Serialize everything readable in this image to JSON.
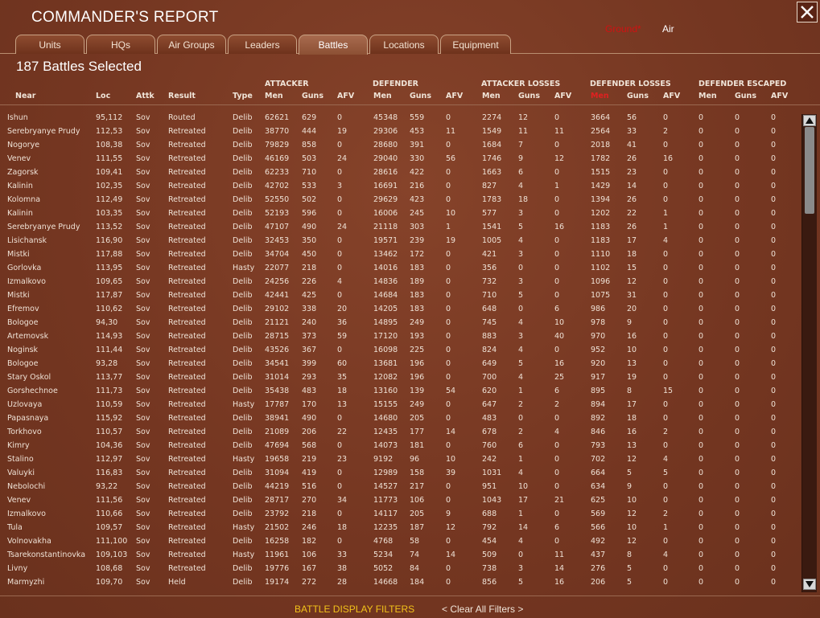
{
  "window": {
    "title": "COMMANDER'S REPORT"
  },
  "mode": {
    "ground": "Ground*",
    "air": "Air"
  },
  "tabs": [
    {
      "label": "Units"
    },
    {
      "label": "HQs"
    },
    {
      "label": "Air Groups"
    },
    {
      "label": "Leaders"
    },
    {
      "label": "Battles"
    },
    {
      "label": "Locations"
    },
    {
      "label": "Equipment"
    }
  ],
  "active_tab": "Battles",
  "selection_count": "187 Battles Selected",
  "groups": {
    "attacker": "ATTACKER",
    "defender": "DEFENDER",
    "attacker_losses": "ATTACKER LOSSES",
    "defender_losses": "DEFENDER LOSSES",
    "defender_escaped": "DEFENDER ESCAPED"
  },
  "columns": [
    "Near",
    "Loc",
    "Attk",
    "Result",
    "Type",
    "Men",
    "Guns",
    "AFV",
    "Men",
    "Guns",
    "AFV",
    "Men",
    "Guns",
    "AFV",
    "Men",
    "Guns",
    "AFV",
    "Men",
    "Guns",
    "AFV"
  ],
  "sorted_column_color": "#e02020",
  "rows": [
    [
      "Ishun",
      "95,112",
      "Sov",
      "Routed",
      "Delib",
      "62621",
      "629",
      "0",
      "45348",
      "559",
      "0",
      "2274",
      "12",
      "0",
      "3664",
      "56",
      "0",
      "0",
      "0",
      "0"
    ],
    [
      "Serebryanye Prudy",
      "112,53",
      "Sov",
      "Retreated",
      "Delib",
      "38770",
      "444",
      "19",
      "29306",
      "453",
      "11",
      "1549",
      "11",
      "11",
      "2564",
      "33",
      "2",
      "0",
      "0",
      "0"
    ],
    [
      "Nogorye",
      "108,38",
      "Sov",
      "Retreated",
      "Delib",
      "79829",
      "858",
      "0",
      "28680",
      "391",
      "0",
      "1684",
      "7",
      "0",
      "2018",
      "41",
      "0",
      "0",
      "0",
      "0"
    ],
    [
      "Venev",
      "111,55",
      "Sov",
      "Retreated",
      "Delib",
      "46169",
      "503",
      "24",
      "29040",
      "330",
      "56",
      "1746",
      "9",
      "12",
      "1782",
      "26",
      "16",
      "0",
      "0",
      "0"
    ],
    [
      "Zagorsk",
      "109,41",
      "Sov",
      "Retreated",
      "Delib",
      "62233",
      "710",
      "0",
      "28616",
      "422",
      "0",
      "1663",
      "6",
      "0",
      "1515",
      "23",
      "0",
      "0",
      "0",
      "0"
    ],
    [
      "Kalinin",
      "102,35",
      "Sov",
      "Retreated",
      "Delib",
      "42702",
      "533",
      "3",
      "16691",
      "216",
      "0",
      "827",
      "4",
      "1",
      "1429",
      "14",
      "0",
      "0",
      "0",
      "0"
    ],
    [
      "Kolomna",
      "112,49",
      "Sov",
      "Retreated",
      "Delib",
      "52550",
      "502",
      "0",
      "29629",
      "423",
      "0",
      "1783",
      "18",
      "0",
      "1394",
      "26",
      "0",
      "0",
      "0",
      "0"
    ],
    [
      "Kalinin",
      "103,35",
      "Sov",
      "Retreated",
      "Delib",
      "52193",
      "596",
      "0",
      "16006",
      "245",
      "10",
      "577",
      "3",
      "0",
      "1202",
      "22",
      "1",
      "0",
      "0",
      "0"
    ],
    [
      "Serebryanye Prudy",
      "113,52",
      "Sov",
      "Retreated",
      "Delib",
      "47107",
      "490",
      "24",
      "21118",
      "303",
      "1",
      "1541",
      "5",
      "16",
      "1183",
      "26",
      "1",
      "0",
      "0",
      "0"
    ],
    [
      "Lisichansk",
      "116,90",
      "Sov",
      "Retreated",
      "Delib",
      "32453",
      "350",
      "0",
      "19571",
      "239",
      "19",
      "1005",
      "4",
      "0",
      "1183",
      "17",
      "4",
      "0",
      "0",
      "0"
    ],
    [
      "Mistki",
      "117,88",
      "Sov",
      "Retreated",
      "Delib",
      "34704",
      "450",
      "0",
      "13462",
      "172",
      "0",
      "421",
      "3",
      "0",
      "1110",
      "18",
      "0",
      "0",
      "0",
      "0"
    ],
    [
      "Gorlovka",
      "113,95",
      "Sov",
      "Retreated",
      "Hasty",
      "22077",
      "218",
      "0",
      "14016",
      "183",
      "0",
      "356",
      "0",
      "0",
      "1102",
      "15",
      "0",
      "0",
      "0",
      "0"
    ],
    [
      "Izmalkovo",
      "109,65",
      "Sov",
      "Retreated",
      "Delib",
      "24256",
      "226",
      "4",
      "14836",
      "189",
      "0",
      "732",
      "3",
      "0",
      "1096",
      "12",
      "0",
      "0",
      "0",
      "0"
    ],
    [
      "Mistki",
      "117,87",
      "Sov",
      "Retreated",
      "Delib",
      "42441",
      "425",
      "0",
      "14684",
      "183",
      "0",
      "710",
      "5",
      "0",
      "1075",
      "31",
      "0",
      "0",
      "0",
      "0"
    ],
    [
      "Efremov",
      "110,62",
      "Sov",
      "Retreated",
      "Delib",
      "29102",
      "338",
      "20",
      "14205",
      "183",
      "0",
      "648",
      "0",
      "6",
      "986",
      "20",
      "0",
      "0",
      "0",
      "0"
    ],
    [
      "Bologoe",
      "94,30",
      "Sov",
      "Retreated",
      "Delib",
      "21121",
      "240",
      "36",
      "14895",
      "249",
      "0",
      "745",
      "4",
      "10",
      "978",
      "9",
      "0",
      "0",
      "0",
      "0"
    ],
    [
      "Artemovsk",
      "114,93",
      "Sov",
      "Retreated",
      "Delib",
      "28715",
      "373",
      "59",
      "17120",
      "193",
      "0",
      "883",
      "3",
      "40",
      "970",
      "16",
      "0",
      "0",
      "0",
      "0"
    ],
    [
      "Noginsk",
      "111,44",
      "Sov",
      "Retreated",
      "Delib",
      "43526",
      "367",
      "0",
      "16098",
      "225",
      "0",
      "824",
      "4",
      "0",
      "952",
      "10",
      "0",
      "0",
      "0",
      "0"
    ],
    [
      "Bologoe",
      "93,28",
      "Sov",
      "Retreated",
      "Delib",
      "34541",
      "399",
      "60",
      "13681",
      "196",
      "0",
      "649",
      "5",
      "16",
      "920",
      "13",
      "0",
      "0",
      "0",
      "0"
    ],
    [
      "Stary Oskol",
      "113,77",
      "Sov",
      "Retreated",
      "Delib",
      "31014",
      "293",
      "35",
      "12082",
      "196",
      "0",
      "700",
      "4",
      "25",
      "917",
      "19",
      "0",
      "0",
      "0",
      "0"
    ],
    [
      "Gorshechnoe",
      "111,73",
      "Sov",
      "Retreated",
      "Delib",
      "35438",
      "483",
      "18",
      "13160",
      "139",
      "54",
      "620",
      "1",
      "6",
      "895",
      "8",
      "15",
      "0",
      "0",
      "0"
    ],
    [
      "Uzlovaya",
      "110,59",
      "Sov",
      "Retreated",
      "Hasty",
      "17787",
      "170",
      "13",
      "15155",
      "249",
      "0",
      "647",
      "2",
      "2",
      "894",
      "17",
      "0",
      "0",
      "0",
      "0"
    ],
    [
      "Papasnaya",
      "115,92",
      "Sov",
      "Retreated",
      "Delib",
      "38941",
      "490",
      "0",
      "14680",
      "205",
      "0",
      "483",
      "0",
      "0",
      "892",
      "18",
      "0",
      "0",
      "0",
      "0"
    ],
    [
      "Torkhovo",
      "110,57",
      "Sov",
      "Retreated",
      "Delib",
      "21089",
      "206",
      "22",
      "12435",
      "177",
      "14",
      "678",
      "2",
      "4",
      "846",
      "16",
      "2",
      "0",
      "0",
      "0"
    ],
    [
      "Kimry",
      "104,36",
      "Sov",
      "Retreated",
      "Delib",
      "47694",
      "568",
      "0",
      "14073",
      "181",
      "0",
      "760",
      "6",
      "0",
      "793",
      "13",
      "0",
      "0",
      "0",
      "0"
    ],
    [
      "Stalino",
      "112,97",
      "Sov",
      "Retreated",
      "Hasty",
      "19658",
      "219",
      "23",
      "9192",
      "96",
      "10",
      "242",
      "1",
      "0",
      "702",
      "12",
      "4",
      "0",
      "0",
      "0"
    ],
    [
      "Valuyki",
      "116,83",
      "Sov",
      "Retreated",
      "Delib",
      "31094",
      "419",
      "0",
      "12989",
      "158",
      "39",
      "1031",
      "4",
      "0",
      "664",
      "5",
      "5",
      "0",
      "0",
      "0"
    ],
    [
      "Nebolochi",
      "93,22",
      "Sov",
      "Retreated",
      "Delib",
      "44219",
      "516",
      "0",
      "14527",
      "217",
      "0",
      "951",
      "10",
      "0",
      "634",
      "9",
      "0",
      "0",
      "0",
      "0"
    ],
    [
      "Venev",
      "111,56",
      "Sov",
      "Retreated",
      "Delib",
      "28717",
      "270",
      "34",
      "11773",
      "106",
      "0",
      "1043",
      "17",
      "21",
      "625",
      "10",
      "0",
      "0",
      "0",
      "0"
    ],
    [
      "Izmalkovo",
      "110,66",
      "Sov",
      "Retreated",
      "Delib",
      "23792",
      "218",
      "0",
      "14117",
      "205",
      "9",
      "688",
      "1",
      "0",
      "569",
      "12",
      "2",
      "0",
      "0",
      "0"
    ],
    [
      "Tula",
      "109,57",
      "Sov",
      "Retreated",
      "Hasty",
      "21502",
      "246",
      "18",
      "12235",
      "187",
      "12",
      "792",
      "14",
      "6",
      "566",
      "10",
      "1",
      "0",
      "0",
      "0"
    ],
    [
      "Volnovakha",
      "111,100",
      "Sov",
      "Retreated",
      "Delib",
      "16258",
      "182",
      "0",
      "4768",
      "58",
      "0",
      "454",
      "4",
      "0",
      "492",
      "12",
      "0",
      "0",
      "0",
      "0"
    ],
    [
      "Tsarekonstantinovka",
      "109,103",
      "Sov",
      "Retreated",
      "Hasty",
      "11961",
      "106",
      "33",
      "5234",
      "74",
      "14",
      "509",
      "0",
      "11",
      "437",
      "8",
      "4",
      "0",
      "0",
      "0"
    ],
    [
      "Livny",
      "108,68",
      "Sov",
      "Retreated",
      "Delib",
      "19776",
      "167",
      "38",
      "5052",
      "84",
      "0",
      "738",
      "3",
      "14",
      "276",
      "5",
      "0",
      "0",
      "0",
      "0"
    ],
    [
      "Marmyzhi",
      "109,70",
      "Sov",
      "Held",
      "Delib",
      "19174",
      "272",
      "28",
      "14668",
      "184",
      "0",
      "856",
      "5",
      "16",
      "206",
      "5",
      "0",
      "0",
      "0",
      "0"
    ]
  ],
  "footer": {
    "filters": "BATTLE DISPLAY FILTERS",
    "clear": "< Clear All Filters >"
  },
  "icons": {
    "close": "close-icon",
    "scroll_up": "arrow-up-icon",
    "scroll_down": "arrow-down-icon"
  }
}
